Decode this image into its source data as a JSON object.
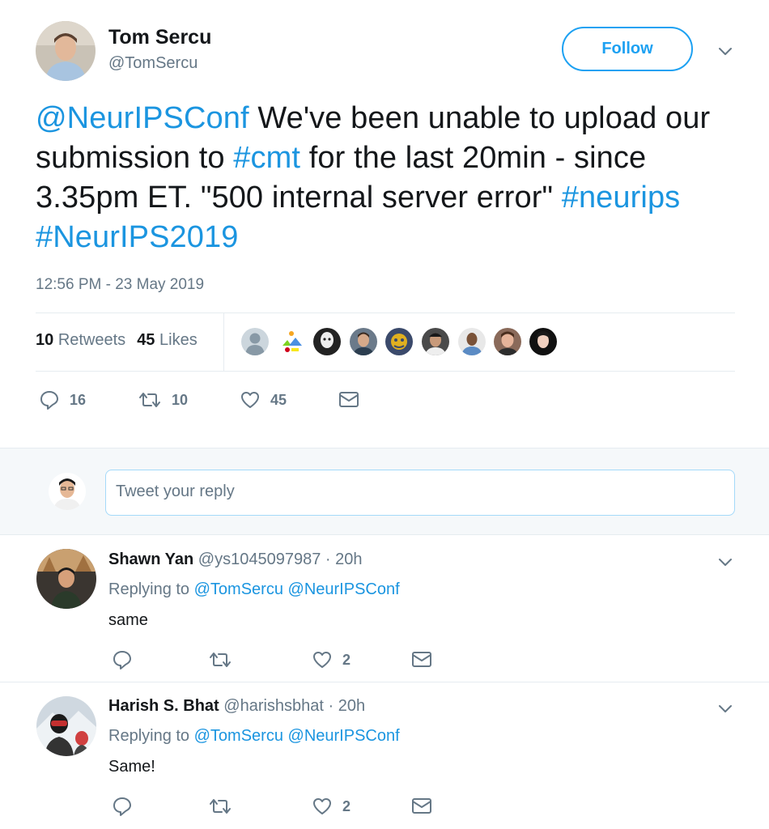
{
  "tweet": {
    "author_name": "Tom Sercu",
    "author_handle": "@TomSercu",
    "follow_label": "Follow",
    "text_parts": [
      {
        "text": "@NeurIPSConf",
        "link": true
      },
      {
        "text": " We've been unable to upload our submission to ",
        "link": false
      },
      {
        "text": "#cmt",
        "link": true
      },
      {
        "text": " for the last 20min - since 3.35pm ET. \"500 internal server error\" ",
        "link": false
      },
      {
        "text": "#neurips",
        "link": true
      },
      {
        "text": " ",
        "link": false
      },
      {
        "text": "#NeurIPS2019",
        "link": true
      }
    ],
    "timestamp": "12:56 PM - 23 May 2019",
    "retweets_count": "10",
    "retweets_label": "Retweets",
    "likes_count": "45",
    "likes_label": "Likes",
    "actions": {
      "reply_count": "16",
      "retweet_count": "10",
      "like_count": "45"
    }
  },
  "reply_composer": {
    "placeholder": "Tweet your reply"
  },
  "replies": [
    {
      "name": "Shawn Yan",
      "handle": "@ys1045097987",
      "time": "· 20h",
      "replying_label": "Replying to",
      "replying_to": "@TomSercu @NeurIPSConf",
      "text": "same",
      "like_count": "2"
    },
    {
      "name": "Harish S. Bhat",
      "handle": "@harishsbhat",
      "time": "· 20h",
      "replying_label": "Replying to",
      "replying_to": "@TomSercu @NeurIPSConf",
      "text": "Same!",
      "like_count": "2"
    }
  ],
  "colors": {
    "brand_blue": "#1da1f2",
    "link_blue": "#1b95e0",
    "secondary_text": "#657786",
    "primary_text": "#14171a",
    "divider": "#e6ecf0"
  }
}
